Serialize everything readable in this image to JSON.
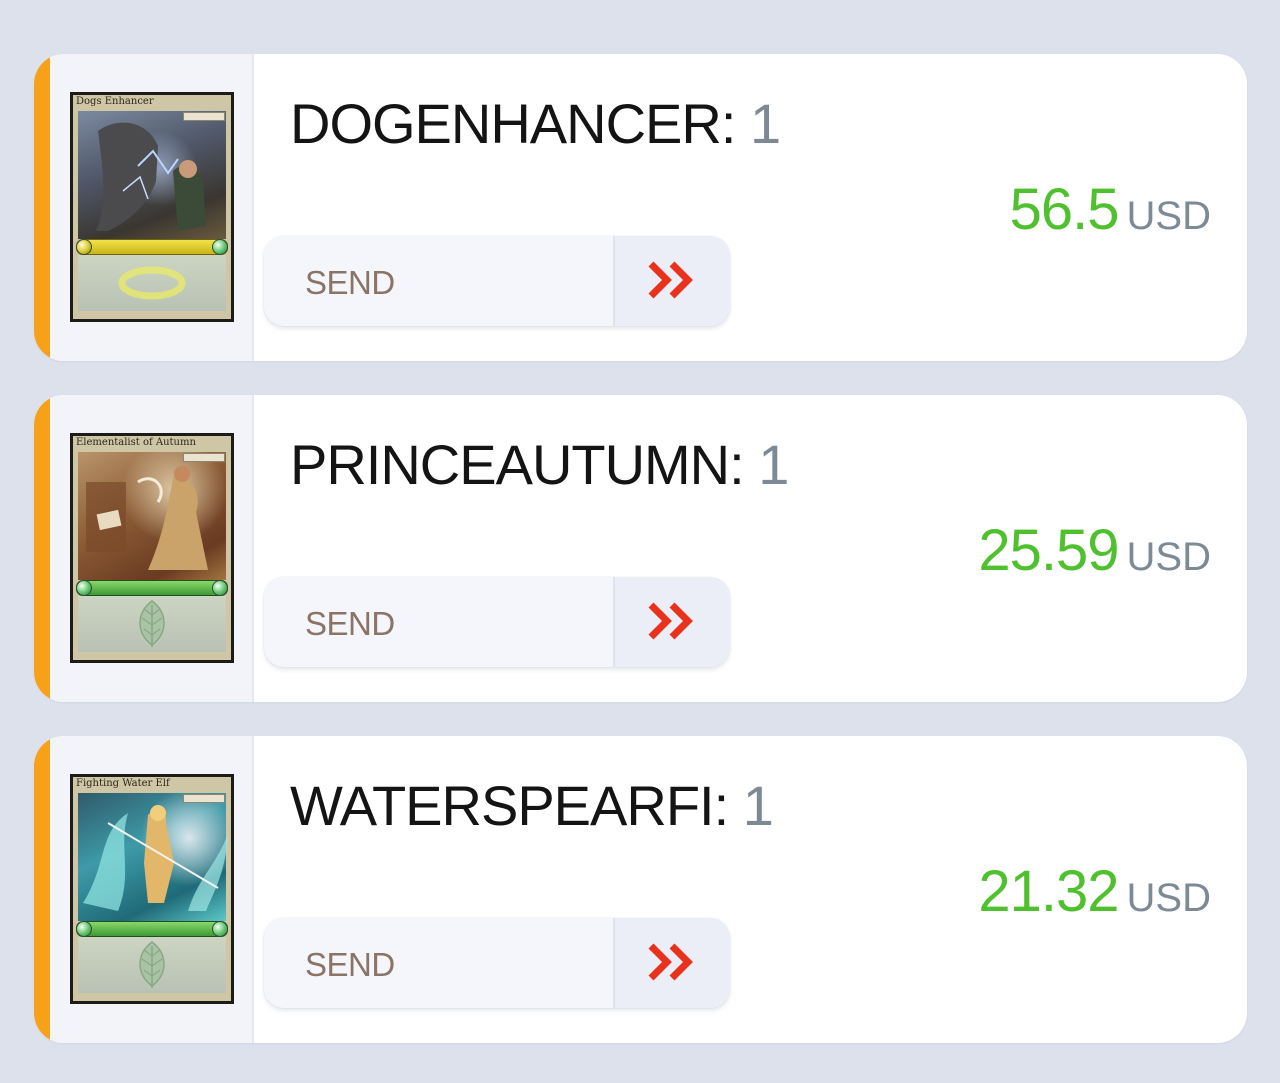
{
  "cards": [
    {
      "thumb_title": "Dogs Enhancer",
      "name": "DOGENHANCER:",
      "quantity": "1",
      "price": "56.5",
      "currency": "USD",
      "send_label": "SEND",
      "thumb_symbol": "ring-icon"
    },
    {
      "thumb_title": "Elementalist of Autumn",
      "name": "PRINCEAUTUMN:",
      "quantity": "1",
      "price": "25.59",
      "currency": "USD",
      "send_label": "SEND",
      "thumb_symbol": "leaf-icon"
    },
    {
      "thumb_title": "Fighting Water Elf",
      "name": "WATERSPEARFI:",
      "quantity": "1",
      "price": "21.32",
      "currency": "USD",
      "send_label": "SEND",
      "thumb_symbol": "leaf-icon"
    }
  ],
  "colors": {
    "background": "#dde1ec",
    "accent": "#f7a11a",
    "price": "#4fc12e",
    "send_arrow": "#e8321c"
  }
}
